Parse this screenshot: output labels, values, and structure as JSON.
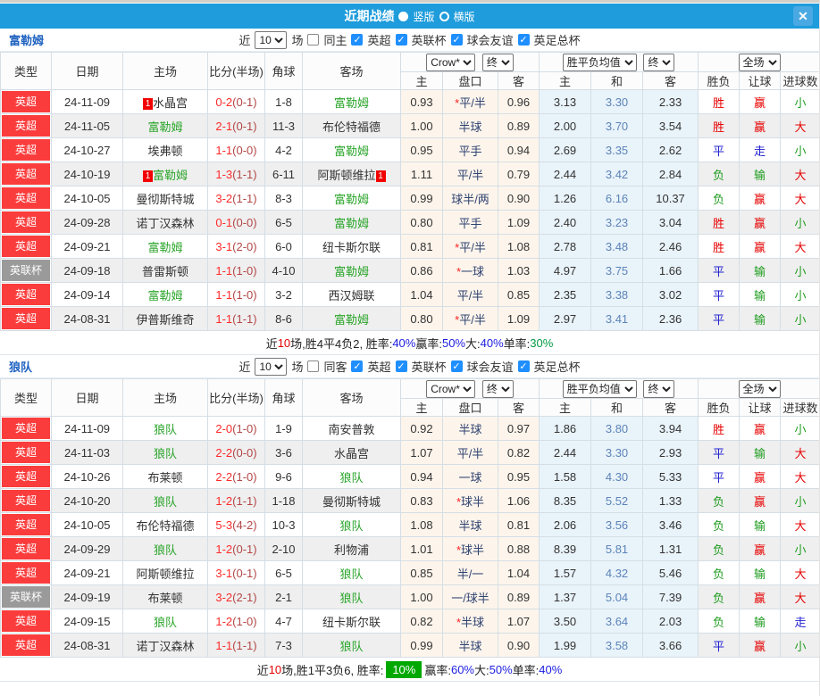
{
  "titlebar": {
    "title": "近期战绩",
    "radio_vertical": "竖版",
    "radio_horizontal": "横版",
    "close_glyph": "✕",
    "bar_color": "#1e9cdb"
  },
  "table_header": {
    "cols": [
      "类型",
      "日期",
      "主场",
      "比分(半场)",
      "角球",
      "客场"
    ],
    "subs": [
      "主",
      "盘口",
      "客",
      "主",
      "和",
      "客",
      "胜负",
      "让球",
      "进球数"
    ],
    "selects": {
      "source": "Crow*",
      "final1": "终",
      "avg": "胜平负均值",
      "final2": "终",
      "scope": "全场"
    }
  },
  "result_colors": {
    "胜": "#e60000",
    "平": "#2020d0",
    "负": "#1f9c1f",
    "赢": "#e60000",
    "走": "#2020d0",
    "输": "#1f9c1f",
    "大": "#e60000",
    "小": "#1f9c1f"
  },
  "check_glyph": "✓",
  "sections": [
    {
      "team": "富勒姆",
      "filter": {
        "near": "近",
        "count": "10",
        "games": "场",
        "same": "同主",
        "leagues": [
          "英超",
          "英联杯",
          "球会友谊",
          "英足总杯"
        ]
      },
      "rows": [
        {
          "league": "英超",
          "lg": "red",
          "date": "24-11-09",
          "home": "水晶宫",
          "hb": "1",
          "hg": false,
          "score": "0-2(0-1)",
          "corner": "1-8",
          "away": "富勒姆",
          "ab": "",
          "ag": true,
          "o1": "0.93",
          "hc": "*平/半",
          "o2": "0.96",
          "a1": "3.13",
          "a2": "3.30",
          "a3": "2.33",
          "r1": "胜",
          "r2": "赢",
          "r3": "小"
        },
        {
          "league": "英超",
          "lg": "red",
          "date": "24-11-05",
          "home": "富勒姆",
          "hb": "",
          "hg": true,
          "score": "2-1(0-1)",
          "corner": "11-3",
          "away": "布伦特福德",
          "ab": "",
          "ag": false,
          "o1": "1.00",
          "hc": "半球",
          "o2": "0.89",
          "a1": "2.00",
          "a2": "3.70",
          "a3": "3.54",
          "r1": "胜",
          "r2": "赢",
          "r3": "大"
        },
        {
          "league": "英超",
          "lg": "red",
          "date": "24-10-27",
          "home": "埃弗顿",
          "hb": "",
          "hg": false,
          "score": "1-1(0-0)",
          "corner": "4-2",
          "away": "富勒姆",
          "ab": "",
          "ag": true,
          "o1": "0.95",
          "hc": "平手",
          "o2": "0.94",
          "a1": "2.69",
          "a2": "3.35",
          "a3": "2.62",
          "r1": "平",
          "r2": "走",
          "r3": "小"
        },
        {
          "league": "英超",
          "lg": "red",
          "date": "24-10-19",
          "home": "富勒姆",
          "hb": "1",
          "hg": true,
          "score": "1-3(1-1)",
          "corner": "6-11",
          "away": "阿斯顿维拉",
          "ab": "1",
          "ag": false,
          "o1": "1.11",
          "hc": "平/半",
          "o2": "0.79",
          "a1": "2.44",
          "a2": "3.42",
          "a3": "2.84",
          "r1": "负",
          "r2": "输",
          "r3": "大"
        },
        {
          "league": "英超",
          "lg": "red",
          "date": "24-10-05",
          "home": "曼彻斯特城",
          "hb": "",
          "hg": false,
          "score": "3-2(1-1)",
          "corner": "8-3",
          "away": "富勒姆",
          "ab": "",
          "ag": true,
          "o1": "0.99",
          "hc": "球半/两",
          "o2": "0.90",
          "a1": "1.26",
          "a2": "6.16",
          "a3": "10.37",
          "r1": "负",
          "r2": "赢",
          "r3": "大"
        },
        {
          "league": "英超",
          "lg": "red",
          "date": "24-09-28",
          "home": "诺丁汉森林",
          "hb": "",
          "hg": false,
          "score": "0-1(0-0)",
          "corner": "6-5",
          "away": "富勒姆",
          "ab": "",
          "ag": true,
          "o1": "0.80",
          "hc": "平手",
          "o2": "1.09",
          "a1": "2.40",
          "a2": "3.23",
          "a3": "3.04",
          "r1": "胜",
          "r2": "赢",
          "r3": "小"
        },
        {
          "league": "英超",
          "lg": "red",
          "date": "24-09-21",
          "home": "富勒姆",
          "hb": "",
          "hg": true,
          "score": "3-1(2-0)",
          "corner": "6-0",
          "away": "纽卡斯尔联",
          "ab": "",
          "ag": false,
          "o1": "0.81",
          "hc": "*平/半",
          "o2": "1.08",
          "a1": "2.78",
          "a2": "3.48",
          "a3": "2.46",
          "r1": "胜",
          "r2": "赢",
          "r3": "大"
        },
        {
          "league": "英联杯",
          "lg": "gray",
          "date": "24-09-18",
          "home": "普雷斯顿",
          "hb": "",
          "hg": false,
          "score": "1-1(1-0)",
          "corner": "4-10",
          "away": "富勒姆",
          "ab": "",
          "ag": true,
          "o1": "0.86",
          "hc": "*一球",
          "o2": "1.03",
          "a1": "4.97",
          "a2": "3.75",
          "a3": "1.66",
          "r1": "平",
          "r2": "输",
          "r3": "小"
        },
        {
          "league": "英超",
          "lg": "red",
          "date": "24-09-14",
          "home": "富勒姆",
          "hb": "",
          "hg": true,
          "score": "1-1(1-0)",
          "corner": "3-2",
          "away": "西汉姆联",
          "ab": "",
          "ag": false,
          "o1": "1.04",
          "hc": "平/半",
          "o2": "0.85",
          "a1": "2.35",
          "a2": "3.38",
          "a3": "3.02",
          "r1": "平",
          "r2": "输",
          "r3": "小"
        },
        {
          "league": "英超",
          "lg": "red",
          "date": "24-08-31",
          "home": "伊普斯维奇",
          "hb": "",
          "hg": false,
          "score": "1-1(1-1)",
          "corner": "8-6",
          "away": "富勒姆",
          "ab": "",
          "ag": true,
          "o1": "0.80",
          "hc": "*平/半",
          "o2": "1.09",
          "a1": "2.97",
          "a2": "3.41",
          "a3": "2.36",
          "r1": "平",
          "r2": "输",
          "r3": "小"
        }
      ],
      "summary": [
        {
          "t": "近"
        },
        {
          "t": "10",
          "c": "red"
        },
        {
          "t": "场,胜4平4负2, 胜率:"
        },
        {
          "t": "40%",
          "c": "blue"
        },
        {
          "t": " 赢率:"
        },
        {
          "t": "50%",
          "c": "blue"
        },
        {
          "t": " 大:"
        },
        {
          "t": "40%",
          "c": "blue"
        },
        {
          "t": " 单率:"
        },
        {
          "t": "30%",
          "c": "green"
        }
      ]
    },
    {
      "team": "狼队",
      "filter": {
        "near": "近",
        "count": "10",
        "games": "场",
        "same": "同客",
        "leagues": [
          "英超",
          "英联杯",
          "球会友谊",
          "英足总杯"
        ]
      },
      "rows": [
        {
          "league": "英超",
          "lg": "red",
          "date": "24-11-09",
          "home": "狼队",
          "hb": "",
          "hg": true,
          "score": "2-0(1-0)",
          "corner": "1-9",
          "away": "南安普敦",
          "ab": "",
          "ag": false,
          "o1": "0.92",
          "hc": "半球",
          "o2": "0.97",
          "a1": "1.86",
          "a2": "3.80",
          "a3": "3.94",
          "r1": "胜",
          "r2": "赢",
          "r3": "小"
        },
        {
          "league": "英超",
          "lg": "red",
          "date": "24-11-03",
          "home": "狼队",
          "hb": "",
          "hg": true,
          "score": "2-2(0-0)",
          "corner": "3-6",
          "away": "水晶宫",
          "ab": "",
          "ag": false,
          "o1": "1.07",
          "hc": "平/半",
          "o2": "0.82",
          "a1": "2.44",
          "a2": "3.30",
          "a3": "2.93",
          "r1": "平",
          "r2": "输",
          "r3": "大"
        },
        {
          "league": "英超",
          "lg": "red",
          "date": "24-10-26",
          "home": "布莱顿",
          "hb": "",
          "hg": false,
          "score": "2-2(1-0)",
          "corner": "9-6",
          "away": "狼队",
          "ab": "",
          "ag": true,
          "o1": "0.94",
          "hc": "一球",
          "o2": "0.95",
          "a1": "1.58",
          "a2": "4.30",
          "a3": "5.33",
          "r1": "平",
          "r2": "赢",
          "r3": "大"
        },
        {
          "league": "英超",
          "lg": "red",
          "date": "24-10-20",
          "home": "狼队",
          "hb": "",
          "hg": true,
          "score": "1-2(1-1)",
          "corner": "1-18",
          "away": "曼彻斯特城",
          "ab": "",
          "ag": false,
          "o1": "0.83",
          "hc": "*球半",
          "o2": "1.06",
          "a1": "8.35",
          "a2": "5.52",
          "a3": "1.33",
          "r1": "负",
          "r2": "赢",
          "r3": "小"
        },
        {
          "league": "英超",
          "lg": "red",
          "date": "24-10-05",
          "home": "布伦特福德",
          "hb": "",
          "hg": false,
          "score": "5-3(4-2)",
          "corner": "10-3",
          "away": "狼队",
          "ab": "",
          "ag": true,
          "o1": "1.08",
          "hc": "半球",
          "o2": "0.81",
          "a1": "2.06",
          "a2": "3.56",
          "a3": "3.46",
          "r1": "负",
          "r2": "输",
          "r3": "大"
        },
        {
          "league": "英超",
          "lg": "red",
          "date": "24-09-29",
          "home": "狼队",
          "hb": "",
          "hg": true,
          "score": "1-2(0-1)",
          "corner": "2-10",
          "away": "利物浦",
          "ab": "",
          "ag": false,
          "o1": "1.01",
          "hc": "*球半",
          "o2": "0.88",
          "a1": "8.39",
          "a2": "5.81",
          "a3": "1.31",
          "r1": "负",
          "r2": "赢",
          "r3": "小"
        },
        {
          "league": "英超",
          "lg": "red",
          "date": "24-09-21",
          "home": "阿斯顿维拉",
          "hb": "",
          "hg": false,
          "score": "3-1(0-1)",
          "corner": "6-5",
          "away": "狼队",
          "ab": "",
          "ag": true,
          "o1": "0.85",
          "hc": "半/一",
          "o2": "1.04",
          "a1": "1.57",
          "a2": "4.32",
          "a3": "5.46",
          "r1": "负",
          "r2": "输",
          "r3": "大"
        },
        {
          "league": "英联杯",
          "lg": "gray",
          "date": "24-09-19",
          "home": "布莱顿",
          "hb": "",
          "hg": false,
          "score": "3-2(2-1)",
          "corner": "2-1",
          "away": "狼队",
          "ab": "",
          "ag": true,
          "o1": "1.00",
          "hc": "一/球半",
          "o2": "0.89",
          "a1": "1.37",
          "a2": "5.04",
          "a3": "7.39",
          "r1": "负",
          "r2": "赢",
          "r3": "大"
        },
        {
          "league": "英超",
          "lg": "red",
          "date": "24-09-15",
          "home": "狼队",
          "hb": "",
          "hg": true,
          "score": "1-2(1-0)",
          "corner": "4-7",
          "away": "纽卡斯尔联",
          "ab": "",
          "ag": false,
          "o1": "0.82",
          "hc": "*半球",
          "o2": "1.07",
          "a1": "3.50",
          "a2": "3.64",
          "a3": "2.03",
          "r1": "负",
          "r2": "输",
          "r3": "走"
        },
        {
          "league": "英超",
          "lg": "red",
          "date": "24-08-31",
          "home": "诺丁汉森林",
          "hb": "",
          "hg": false,
          "score": "1-1(1-1)",
          "corner": "7-3",
          "away": "狼队",
          "ab": "",
          "ag": true,
          "o1": "0.99",
          "hc": "半球",
          "o2": "0.90",
          "a1": "1.99",
          "a2": "3.58",
          "a3": "3.66",
          "r1": "平",
          "r2": "赢",
          "r3": "小"
        }
      ],
      "summary": [
        {
          "t": "近"
        },
        {
          "t": "10",
          "c": "red"
        },
        {
          "t": "场,胜1平3负6, 胜率:"
        },
        {
          "t": "10%",
          "c": "hl"
        },
        {
          "t": " 赢率:"
        },
        {
          "t": "60%",
          "c": "blue"
        },
        {
          "t": " 大:"
        },
        {
          "t": "50%",
          "c": "blue"
        },
        {
          "t": " 单率:"
        },
        {
          "t": "40%",
          "c": "blue"
        }
      ]
    }
  ]
}
